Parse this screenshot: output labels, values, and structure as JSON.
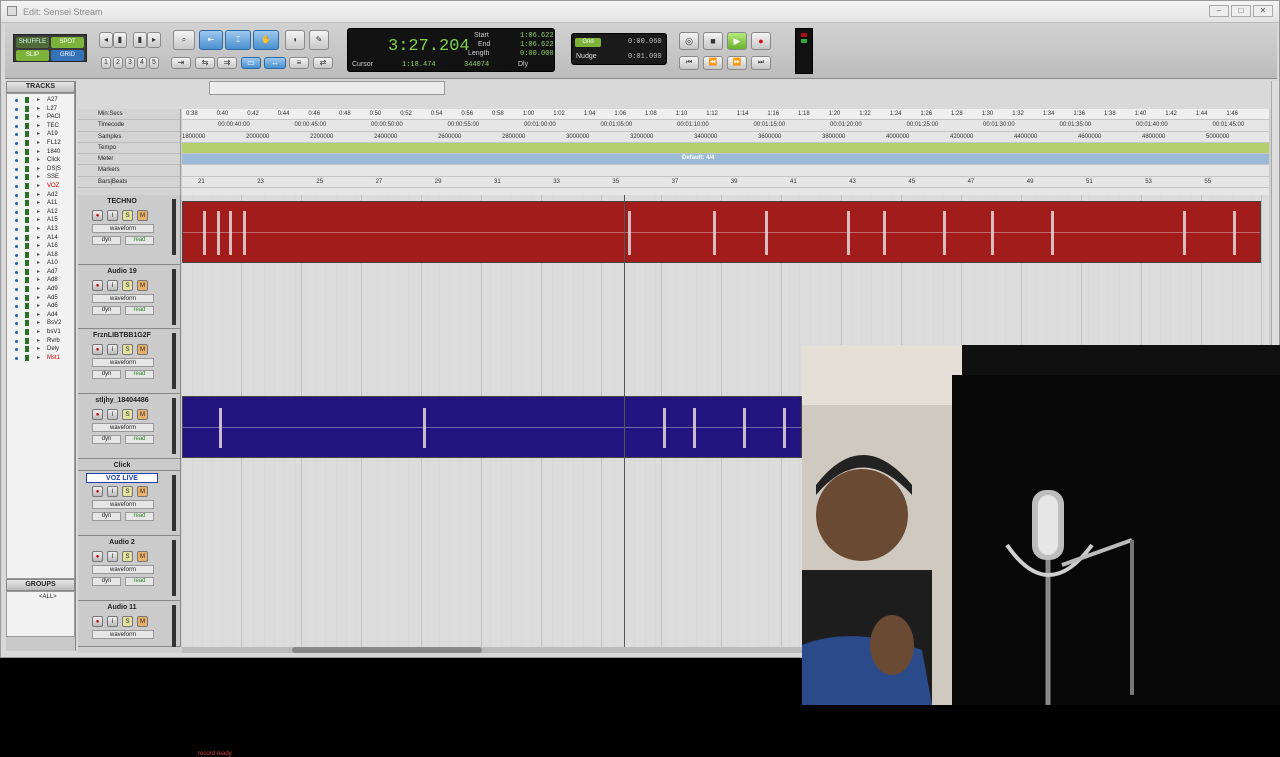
{
  "window": {
    "title": "Edit: Sensei Stream"
  },
  "toolbar": {
    "modes": [
      "SHUFFLE",
      "SPOT",
      "SLIP",
      "GRID"
    ],
    "zoom_presets": [
      "1",
      "2",
      "3",
      "4",
      "5"
    ]
  },
  "counter": {
    "main": "3:27.204",
    "cursor_label": "Cursor",
    "cursor_value": "1:18.474",
    "samples_value": "344074",
    "start_label": "Start",
    "end_label": "End",
    "length_label": "Length",
    "start_value": "1:06.622",
    "end_value": "1:06.622",
    "length_value": "0:00.000",
    "dly_label": "Dly"
  },
  "grid": {
    "grid_label": "Grid",
    "grid_value": "0:00.060",
    "nudge_label": "Nudge",
    "nudge_value": "0:01.000"
  },
  "lists": {
    "tracks_header": "TRACKS",
    "groups_header": "GROUPS",
    "groups_all": "<ALL>",
    "tracks": [
      "A27",
      "L27",
      "PACI",
      "TEC",
      "A19",
      "FL12",
      "1840",
      "Click",
      "DS|S",
      "SSE",
      "VOZ",
      "Ad2",
      "A11",
      "A12",
      "A15",
      "A13",
      "A14",
      "A16",
      "A18",
      "A10",
      "Ad7",
      "Ad8",
      "Ad9",
      "Ad5",
      "Ad6",
      "Ad4",
      "BsV2",
      "bsV1",
      "Rvrb",
      "Dely",
      "Mst1"
    ]
  },
  "rulers": {
    "labels": [
      "Min:Secs",
      "Timecode",
      "Samples",
      "Tempo",
      "Meter",
      "Markers",
      "Bars|Beats"
    ],
    "minsecs": [
      "0:38",
      "0:40",
      "0:42",
      "0:44",
      "0:46",
      "0:48",
      "0:50",
      "0:52",
      "0:54",
      "0:56",
      "0:58",
      "1:00",
      "1:02",
      "1:04",
      "1:06",
      "1:08",
      "1:10",
      "1:12",
      "1:14",
      "1:16",
      "1:18",
      "1:20",
      "1:22",
      "1:24",
      "1:26",
      "1:28",
      "1:30",
      "1:32",
      "1:34",
      "1:36",
      "1:38",
      "1:40",
      "1:42",
      "1:44",
      "1:46"
    ],
    "timecode": [
      "00:00:40:00",
      "00:00:45:00",
      "00:00:50:00",
      "00:00:55:00",
      "00:01:00:00",
      "00:01:05:00",
      "00:01:10:00",
      "00:01:15:00",
      "00:01:20:00",
      "00:01:25:00",
      "00:01:30:00",
      "00:01:35:00",
      "00:01:40:00",
      "00:01:45:00"
    ],
    "samples": [
      "1800000",
      "2000000",
      "2200000",
      "2400000",
      "2600000",
      "2800000",
      "3000000",
      "3200000",
      "3400000",
      "3600000",
      "3800000",
      "4000000",
      "4200000",
      "4400000",
      "4600000",
      "4800000",
      "5000000"
    ],
    "meter_text": "Default: 4/4",
    "bars": [
      "21",
      "23",
      "25",
      "27",
      "29",
      "31",
      "33",
      "35",
      "37",
      "39",
      "41",
      "43",
      "45",
      "47",
      "49",
      "51",
      "53",
      "55"
    ]
  },
  "tracks": [
    {
      "name": "TECHNO",
      "view": "waveform",
      "dyn": "dyn",
      "auto": "read"
    },
    {
      "name": "Audio 19",
      "view": "waveform",
      "dyn": "dyn",
      "auto": "read"
    },
    {
      "name": "FrznLIBTBB1G2F",
      "view": "waveform",
      "dyn": "dyn",
      "auto": "read"
    },
    {
      "name": "stljhy_18404486",
      "view": "waveform",
      "dyn": "dyn",
      "auto": "read"
    },
    {
      "name": "Click"
    },
    {
      "name": "VOZ LIVE",
      "view": "waveform",
      "dyn": "dyn",
      "auto": "read"
    },
    {
      "name": "Audio 2",
      "view": "waveform",
      "dyn": "dyn",
      "auto": "read"
    },
    {
      "name": "Audio 11",
      "view": "waveform"
    }
  ],
  "status": {
    "footer": "record ready"
  },
  "colors": {
    "red_clip": "#a21c1c",
    "blue_clip": "#23147f",
    "counter_green": "#7fd14f"
  }
}
